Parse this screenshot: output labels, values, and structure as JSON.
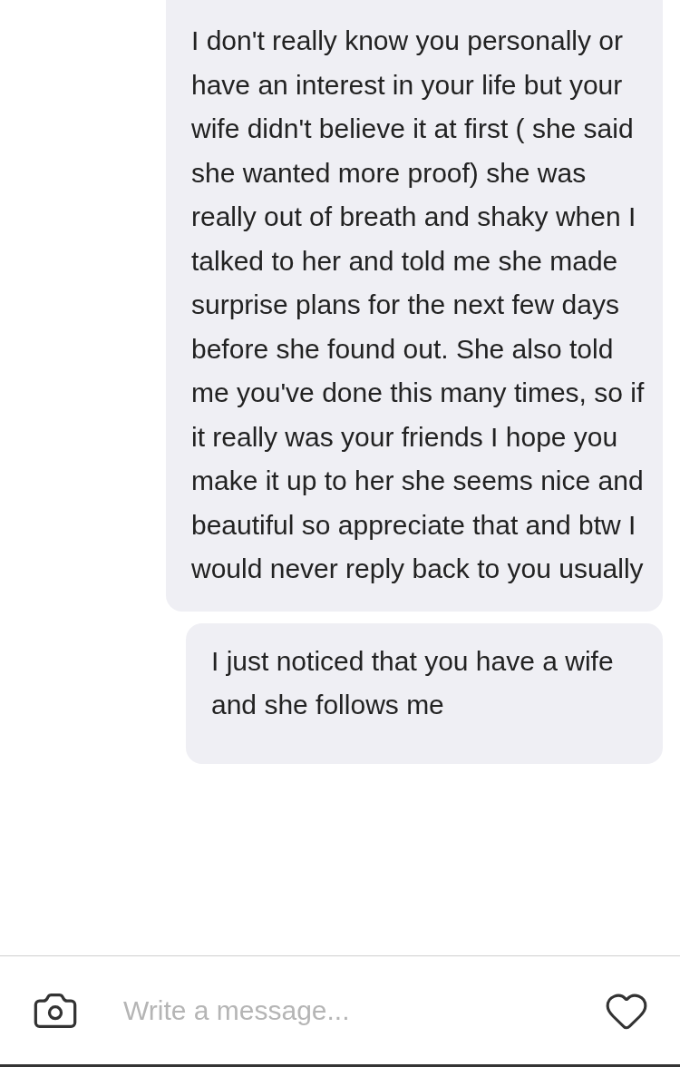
{
  "messages": [
    {
      "text": "I don't really know you personally or have an interest in your life but your wife didn't believe it at first ( she said she wanted more proof) she was really out of breath and shaky when I talked to her and told me she made surprise plans for the next few days before she found out. She also told me you've done this many times, so if it really was your friends I hope you make it up to her she seems nice and beautiful so appreciate that and btw I would never reply back to you usually"
    },
    {
      "text": "I just noticed that you have a wife and she follows me"
    }
  ],
  "composer": {
    "placeholder": "Write a message..."
  }
}
